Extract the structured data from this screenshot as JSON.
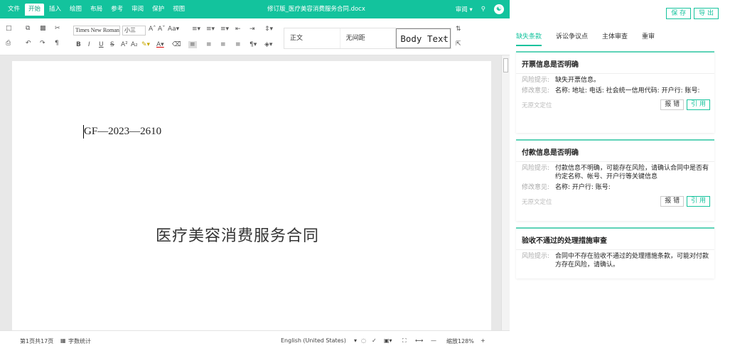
{
  "titlebar": {
    "menus": [
      "文件",
      "开始",
      "插入",
      "绘图",
      "布局",
      "参考",
      "审阅",
      "保护",
      "视图"
    ],
    "doc_title": "修订版_医疗美容消费服务合同.docx",
    "review_label": "审阅 ▾"
  },
  "toolbar": {
    "font_name": "Times New Roman",
    "font_size": "小三",
    "styles": [
      "正文",
      "无间距",
      "Body Text"
    ]
  },
  "document": {
    "doc_number": "GF—2023—2610",
    "doc_title": "医疗美容消费服务合同"
  },
  "status": {
    "page_info": "第1页共17页",
    "word_count": "字数统计",
    "language": "English (United States)",
    "zoom": "缩放128%"
  },
  "panel": {
    "save_label": "保 存",
    "export_label": "导 出",
    "tabs": [
      "缺失条款",
      "诉讼争议点",
      "主体审查",
      "重审"
    ],
    "active_tab": 0,
    "cards": [
      {
        "title": "开票信息是否明确",
        "rows": [
          {
            "k": "风险提示:",
            "v": "缺失开票信息。"
          },
          {
            "k": "修改意见:",
            "v": "名称:  地址:  电话:  社会统一信用代码:  开户行:  账号:"
          }
        ],
        "location": "无原文定位",
        "report_label": "报 错",
        "cite_label": "引 用"
      },
      {
        "title": "付款信息是否明确",
        "rows": [
          {
            "k": "风险提示:",
            "v": "付款信息不明确，可能存在风险，请确认合同中是否有约定名称、帐号、开户行等关键信息"
          },
          {
            "k": "修改意见:",
            "v": "名称:  开户行:  账号:"
          }
        ],
        "location": "无原文定位",
        "report_label": "报 错",
        "cite_label": "引 用"
      },
      {
        "title": "验收不通过的处理措施审查",
        "rows": [
          {
            "k": "风险提示:",
            "v": "合同中不存在验收不通过的处理措施条款，可能对付款方存在风险，请确认。"
          }
        ]
      }
    ]
  }
}
